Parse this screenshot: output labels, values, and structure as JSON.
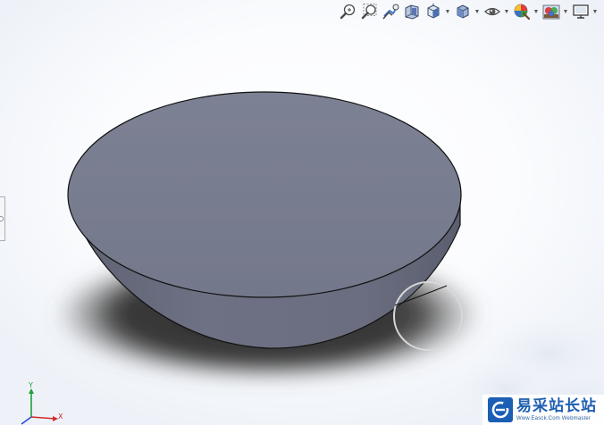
{
  "toolbar": {
    "buttons": [
      {
        "name": "zoom-to-fit",
        "icon": "zoom-to-fit-icon",
        "dropdown": false
      },
      {
        "name": "zoom-to-area",
        "icon": "zoom-to-area-icon",
        "dropdown": false
      },
      {
        "name": "previous-view",
        "icon": "previous-view-icon",
        "dropdown": false
      },
      {
        "name": "section-view",
        "icon": "section-view-icon",
        "dropdown": false
      },
      {
        "name": "view-orientation",
        "icon": "view-orientation-icon",
        "dropdown": true
      },
      {
        "name": "display-style",
        "icon": "display-style-icon",
        "dropdown": true
      },
      {
        "name": "hide-show-items",
        "icon": "hide-show-icon",
        "dropdown": true
      },
      {
        "name": "edit-appearance",
        "icon": "edit-appearance-icon",
        "dropdown": true
      },
      {
        "name": "apply-scene",
        "icon": "apply-scene-icon",
        "dropdown": true
      },
      {
        "name": "view-settings",
        "icon": "monitor-icon",
        "dropdown": true
      }
    ]
  },
  "triad": {
    "y_label": "Y",
    "x_label": "X"
  },
  "watermark": {
    "title": "易采站长站",
    "url": "Www.Easck.Com Webmaster"
  },
  "colors": {
    "model_face": "#7a7e90",
    "model_edge": "#111111",
    "shadow": "#3c3c3c",
    "triad_y": "#1f9e3a",
    "triad_x": "#d02a2a",
    "triad_z": "#2a4fd0",
    "watermark_blue": "#1f5fb0"
  }
}
